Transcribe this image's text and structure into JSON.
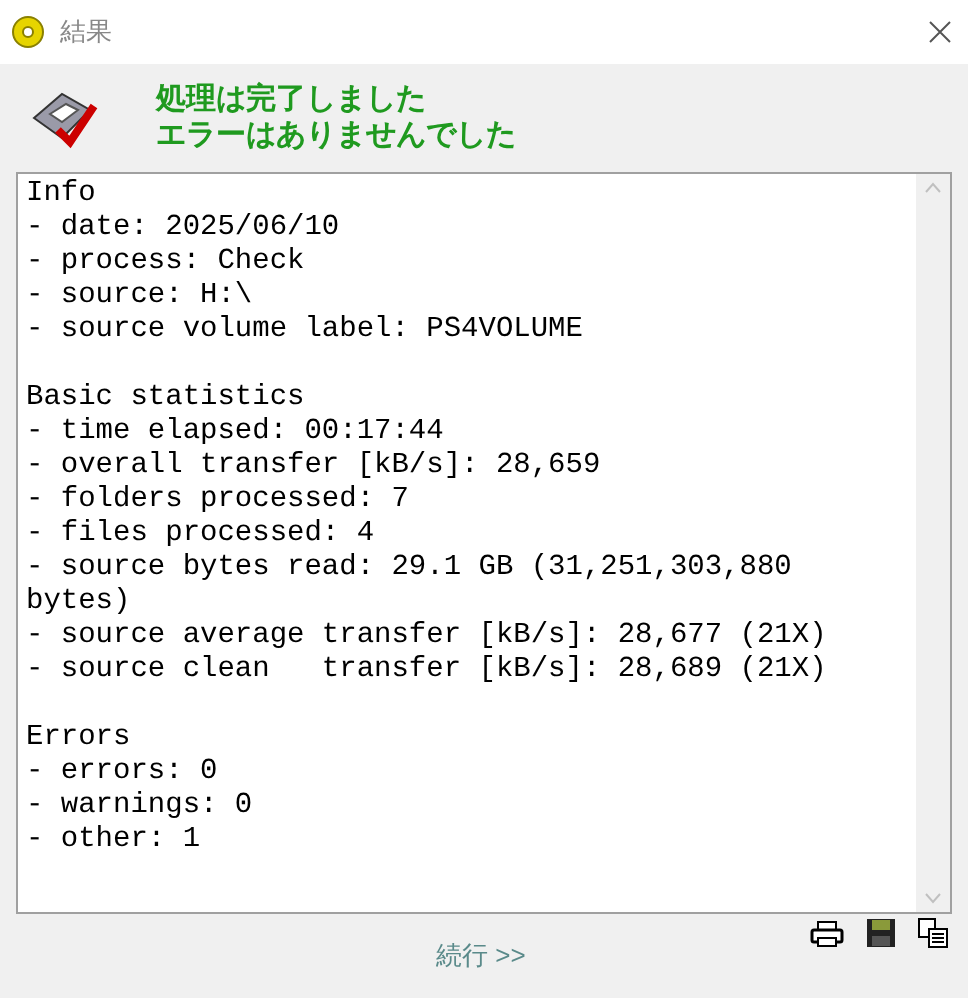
{
  "window": {
    "title": "結果"
  },
  "message": {
    "lines": [
      "処理は完了しました",
      "エラーはありませんでした"
    ]
  },
  "log": {
    "sections": [
      {
        "heading": "Info",
        "lines": [
          "- date: 2025/06/10",
          "- process: Check",
          "- source: H:\\",
          "- source volume label: PS4VOLUME"
        ]
      },
      {
        "heading": "Basic statistics",
        "lines": [
          "- time elapsed: 00:17:44",
          "- overall transfer [kB/s]: 28,659",
          "- folders processed: 7",
          "- files processed: 4",
          "- source bytes read: 29.1 GB (31,251,303,880 bytes)",
          "- source average transfer [kB/s]: 28,677 (21X)",
          "- source clean   transfer [kB/s]: 28,689 (21X)"
        ]
      },
      {
        "heading": "Errors",
        "lines": [
          "- errors: 0",
          "- warnings: 0",
          "- other: 1"
        ]
      }
    ]
  },
  "continue_link": "続行 >>"
}
